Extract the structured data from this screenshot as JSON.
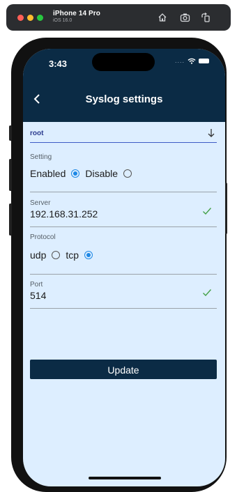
{
  "simulator": {
    "device_name": "iPhone 14 Pro",
    "os_version": "iOS 16.0",
    "icons": [
      "home-icon",
      "screenshot-icon",
      "rotate-icon"
    ]
  },
  "status_bar": {
    "time": "3:43",
    "signal": "....",
    "icons": [
      "wifi-icon",
      "battery-icon"
    ]
  },
  "nav": {
    "title": "Syslog settings",
    "back_icon": "chevron-left-icon"
  },
  "user_select": {
    "value": "root",
    "icon": "arrow-down-icon"
  },
  "setting": {
    "label": "Setting",
    "options": [
      {
        "label": "Enabled",
        "checked": true
      },
      {
        "label": "Disable",
        "checked": false
      }
    ]
  },
  "server": {
    "label": "Server",
    "value": "192.168.31.252",
    "valid": true
  },
  "protocol": {
    "label": "Protocol",
    "options": [
      {
        "label": "udp",
        "checked": false
      },
      {
        "label": "tcp",
        "checked": true
      }
    ]
  },
  "port": {
    "label": "Port",
    "value": "514",
    "valid": true
  },
  "update_button": {
    "label": "Update"
  },
  "colors": {
    "header_bg": "#0b2b45",
    "screen_bg": "#ddeeff",
    "accent": "#1e88e5",
    "valid": "#43a047"
  }
}
